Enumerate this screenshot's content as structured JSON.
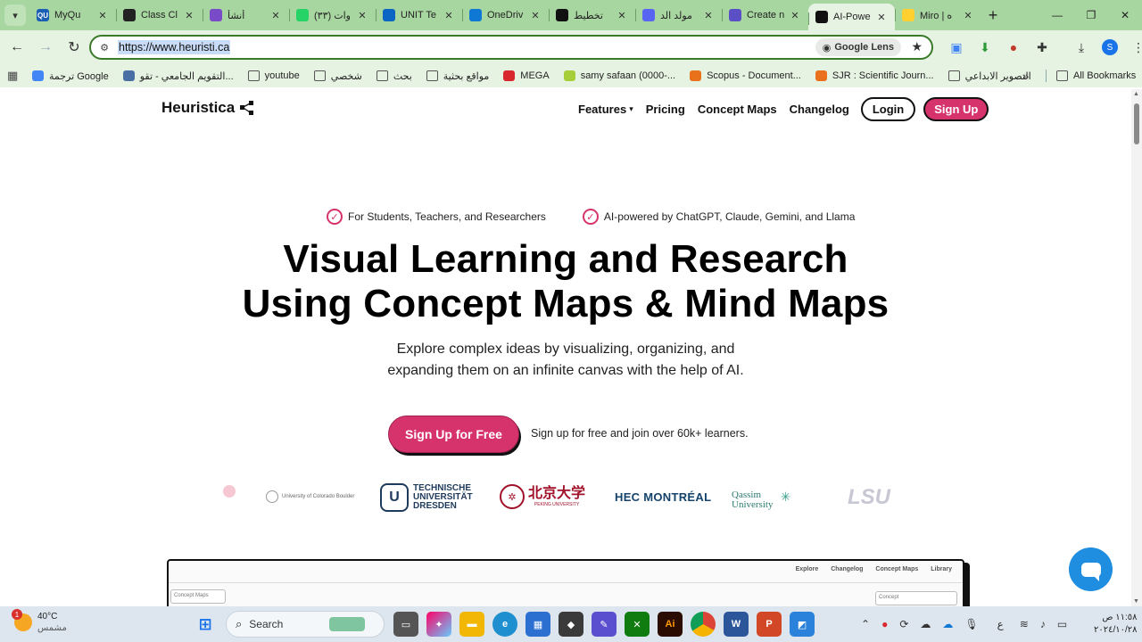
{
  "browser": {
    "tabs": [
      {
        "title": "MyQu",
        "fav_color": "#1a5fb4",
        "fav_text": "QU"
      },
      {
        "title": "Class Cl",
        "fav_color": "#222222",
        "fav_text": ""
      },
      {
        "title": "أنشأ",
        "fav_color": "#7a4bc9",
        "fav_text": ""
      },
      {
        "title": "(٣٣) وات",
        "fav_color": "#25d366",
        "fav_text": ""
      },
      {
        "title": "UNIT Te",
        "fav_color": "#0a66c2",
        "fav_text": ""
      },
      {
        "title": "OneDriv",
        "fav_color": "#0f78d4",
        "fav_text": ""
      },
      {
        "title": "تخطيط",
        "fav_color": "#111111",
        "fav_text": ""
      },
      {
        "title": "مولد الد",
        "fav_color": "#5865f2",
        "fav_text": ""
      },
      {
        "title": "Create n",
        "fav_color": "#5b4fc6",
        "fav_text": ""
      },
      {
        "title": "AI-Powe",
        "fav_color": "#111111",
        "fav_text": "",
        "active": true
      },
      {
        "title": "Miro | ه",
        "fav_color": "#ffd02f",
        "fav_text": ""
      }
    ],
    "url": "https://www.heuristi.ca",
    "lens_label": "Google Lens",
    "profile_initial": "S",
    "bookmarks": [
      {
        "label": "ترجمة Google",
        "color": "#4285f4"
      },
      {
        "label": "التقويم الجامعي - تقو...",
        "color": "#4a6fa5"
      },
      {
        "label": "youtube",
        "color": ""
      },
      {
        "label": "شخصي",
        "color": ""
      },
      {
        "label": "بحث",
        "color": ""
      },
      {
        "label": "مواقع بحثية",
        "color": ""
      },
      {
        "label": "MEGA",
        "color": "#d9272e"
      },
      {
        "label": "samy safaan (0000-...",
        "color": "#a6ce39"
      },
      {
        "label": "Scopus - Document...",
        "color": "#e9711c"
      },
      {
        "label": "SJR : Scientific Journ...",
        "color": "#e9711c"
      },
      {
        "label": "التصوير الابداعي",
        "color": ""
      }
    ],
    "all_bookmarks": "All Bookmarks"
  },
  "site": {
    "brand": "Heuristica",
    "nav": {
      "features": "Features",
      "pricing": "Pricing",
      "concept_maps": "Concept Maps",
      "changelog": "Changelog",
      "login": "Login",
      "signup": "Sign Up"
    },
    "badges": [
      "For Students, Teachers, and Researchers",
      "AI-powered by ChatGPT, Claude, Gemini, and Llama"
    ],
    "hero_title_line1": "Visual Learning and Research",
    "hero_title_line2": "Using Concept Maps & Mind Maps",
    "hero_subtitle": "Explore complex ideas by visualizing, organizing, and expanding them on an infinite canvas with the help of AI.",
    "cta": "Sign Up for Free",
    "cta_note": "Sign up for free and join over 60k+ learners.",
    "logos": {
      "colorado": "University of Colorado Boulder",
      "dresden_1": "TECHNISCHE",
      "dresden_2": "UNIVERSITÄT",
      "dresden_3": "DRESDEN",
      "peking_cn": "北京大学",
      "peking_en": "PEKING UNIVERSITY",
      "hec": "HEC MONTRÉAL",
      "qassim_1": "Qassim",
      "qassim_2": "University",
      "lsu": "LSU"
    },
    "preview_nav": [
      "Explore",
      "Changelog",
      "Concept Maps",
      "Library"
    ],
    "preview_box_left": "Concept Maps",
    "preview_box_right": "Concept"
  },
  "taskbar": {
    "temperature": "40°C",
    "condition": "مشمس",
    "weather_badge": "1",
    "search": "Search",
    "time": "١١:٥٨ ص",
    "date": "٢٠٢٤/١٠/٢٨",
    "lang": "ع"
  },
  "colors": {
    "accent": "#d6336c",
    "chrome_green": "#a8d6a0",
    "toolbar_green": "#e6f3e2",
    "chat_blue": "#1f8ee0"
  }
}
